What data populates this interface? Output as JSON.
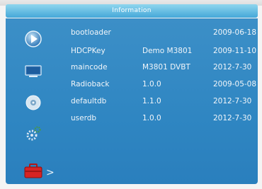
{
  "window": {
    "title": "Information"
  },
  "sidebar": {
    "icons": [
      {
        "name": "play-icon"
      },
      {
        "name": "display-icon"
      },
      {
        "name": "disc-icon"
      },
      {
        "name": "settings-gear-icon"
      },
      {
        "name": "toolbox-icon"
      }
    ],
    "selected_arrow": ">"
  },
  "table": {
    "rows": [
      {
        "name": "bootloader",
        "version": "",
        "date": "2009-06-18"
      },
      {
        "name": "HDCPKey",
        "version": "Demo M3801",
        "date": "2009-11-10"
      },
      {
        "name": "maincode",
        "version": "M3801 DVBT",
        "date": "2012-7-30"
      },
      {
        "name": "Radioback",
        "version": "1.0.0",
        "date": "2009-05-08"
      },
      {
        "name": "defaultdb",
        "version": "1.1.0",
        "date": "2012-7-30"
      },
      {
        "name": "userdb",
        "version": "1.0.0",
        "date": "2012-7-30"
      }
    ]
  },
  "colors": {
    "title_bar": "#5cb7e2",
    "panel": "#2f86c2",
    "text": "#f2f6fa"
  }
}
